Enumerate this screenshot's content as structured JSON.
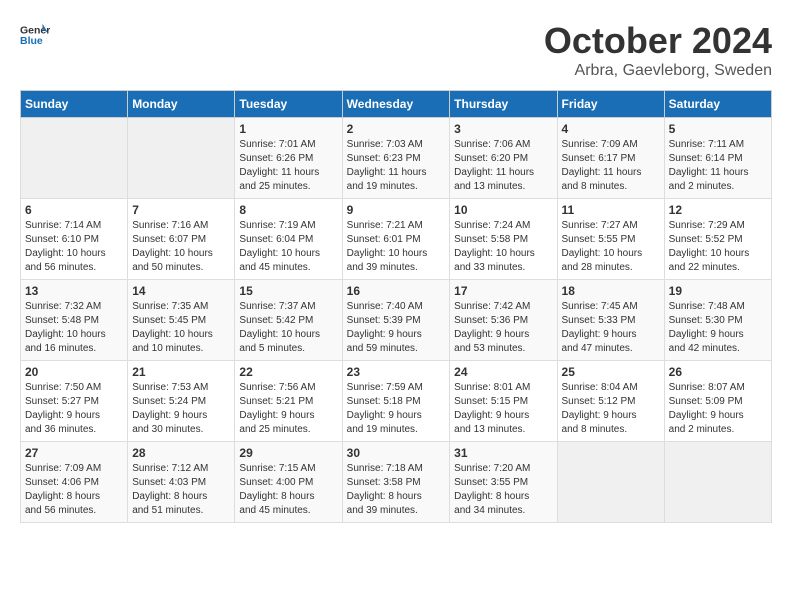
{
  "header": {
    "logo_line1": "General",
    "logo_line2": "Blue",
    "month": "October 2024",
    "location": "Arbra, Gaevleborg, Sweden"
  },
  "days_of_week": [
    "Sunday",
    "Monday",
    "Tuesday",
    "Wednesday",
    "Thursday",
    "Friday",
    "Saturday"
  ],
  "weeks": [
    [
      {
        "day": "",
        "info": ""
      },
      {
        "day": "",
        "info": ""
      },
      {
        "day": "1",
        "info": "Sunrise: 7:01 AM\nSunset: 6:26 PM\nDaylight: 11 hours\nand 25 minutes."
      },
      {
        "day": "2",
        "info": "Sunrise: 7:03 AM\nSunset: 6:23 PM\nDaylight: 11 hours\nand 19 minutes."
      },
      {
        "day": "3",
        "info": "Sunrise: 7:06 AM\nSunset: 6:20 PM\nDaylight: 11 hours\nand 13 minutes."
      },
      {
        "day": "4",
        "info": "Sunrise: 7:09 AM\nSunset: 6:17 PM\nDaylight: 11 hours\nand 8 minutes."
      },
      {
        "day": "5",
        "info": "Sunrise: 7:11 AM\nSunset: 6:14 PM\nDaylight: 11 hours\nand 2 minutes."
      }
    ],
    [
      {
        "day": "6",
        "info": "Sunrise: 7:14 AM\nSunset: 6:10 PM\nDaylight: 10 hours\nand 56 minutes."
      },
      {
        "day": "7",
        "info": "Sunrise: 7:16 AM\nSunset: 6:07 PM\nDaylight: 10 hours\nand 50 minutes."
      },
      {
        "day": "8",
        "info": "Sunrise: 7:19 AM\nSunset: 6:04 PM\nDaylight: 10 hours\nand 45 minutes."
      },
      {
        "day": "9",
        "info": "Sunrise: 7:21 AM\nSunset: 6:01 PM\nDaylight: 10 hours\nand 39 minutes."
      },
      {
        "day": "10",
        "info": "Sunrise: 7:24 AM\nSunset: 5:58 PM\nDaylight: 10 hours\nand 33 minutes."
      },
      {
        "day": "11",
        "info": "Sunrise: 7:27 AM\nSunset: 5:55 PM\nDaylight: 10 hours\nand 28 minutes."
      },
      {
        "day": "12",
        "info": "Sunrise: 7:29 AM\nSunset: 5:52 PM\nDaylight: 10 hours\nand 22 minutes."
      }
    ],
    [
      {
        "day": "13",
        "info": "Sunrise: 7:32 AM\nSunset: 5:48 PM\nDaylight: 10 hours\nand 16 minutes."
      },
      {
        "day": "14",
        "info": "Sunrise: 7:35 AM\nSunset: 5:45 PM\nDaylight: 10 hours\nand 10 minutes."
      },
      {
        "day": "15",
        "info": "Sunrise: 7:37 AM\nSunset: 5:42 PM\nDaylight: 10 hours\nand 5 minutes."
      },
      {
        "day": "16",
        "info": "Sunrise: 7:40 AM\nSunset: 5:39 PM\nDaylight: 9 hours\nand 59 minutes."
      },
      {
        "day": "17",
        "info": "Sunrise: 7:42 AM\nSunset: 5:36 PM\nDaylight: 9 hours\nand 53 minutes."
      },
      {
        "day": "18",
        "info": "Sunrise: 7:45 AM\nSunset: 5:33 PM\nDaylight: 9 hours\nand 47 minutes."
      },
      {
        "day": "19",
        "info": "Sunrise: 7:48 AM\nSunset: 5:30 PM\nDaylight: 9 hours\nand 42 minutes."
      }
    ],
    [
      {
        "day": "20",
        "info": "Sunrise: 7:50 AM\nSunset: 5:27 PM\nDaylight: 9 hours\nand 36 minutes."
      },
      {
        "day": "21",
        "info": "Sunrise: 7:53 AM\nSunset: 5:24 PM\nDaylight: 9 hours\nand 30 minutes."
      },
      {
        "day": "22",
        "info": "Sunrise: 7:56 AM\nSunset: 5:21 PM\nDaylight: 9 hours\nand 25 minutes."
      },
      {
        "day": "23",
        "info": "Sunrise: 7:59 AM\nSunset: 5:18 PM\nDaylight: 9 hours\nand 19 minutes."
      },
      {
        "day": "24",
        "info": "Sunrise: 8:01 AM\nSunset: 5:15 PM\nDaylight: 9 hours\nand 13 minutes."
      },
      {
        "day": "25",
        "info": "Sunrise: 8:04 AM\nSunset: 5:12 PM\nDaylight: 9 hours\nand 8 minutes."
      },
      {
        "day": "26",
        "info": "Sunrise: 8:07 AM\nSunset: 5:09 PM\nDaylight: 9 hours\nand 2 minutes."
      }
    ],
    [
      {
        "day": "27",
        "info": "Sunrise: 7:09 AM\nSunset: 4:06 PM\nDaylight: 8 hours\nand 56 minutes."
      },
      {
        "day": "28",
        "info": "Sunrise: 7:12 AM\nSunset: 4:03 PM\nDaylight: 8 hours\nand 51 minutes."
      },
      {
        "day": "29",
        "info": "Sunrise: 7:15 AM\nSunset: 4:00 PM\nDaylight: 8 hours\nand 45 minutes."
      },
      {
        "day": "30",
        "info": "Sunrise: 7:18 AM\nSunset: 3:58 PM\nDaylight: 8 hours\nand 39 minutes."
      },
      {
        "day": "31",
        "info": "Sunrise: 7:20 AM\nSunset: 3:55 PM\nDaylight: 8 hours\nand 34 minutes."
      },
      {
        "day": "",
        "info": ""
      },
      {
        "day": "",
        "info": ""
      }
    ]
  ]
}
